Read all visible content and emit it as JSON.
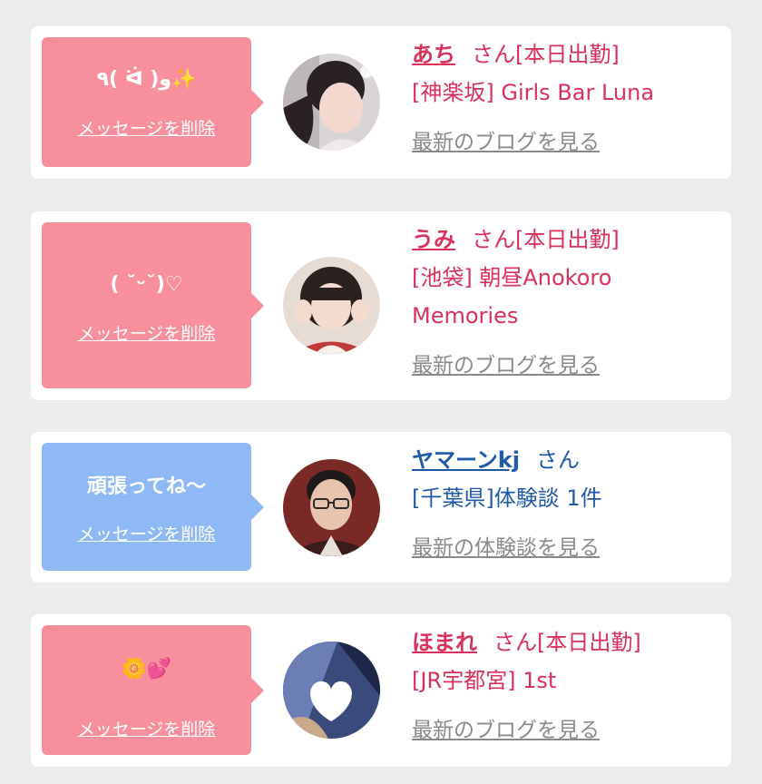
{
  "colors": {
    "pink_bubble": "#f7909c",
    "blue_bubble": "#8fb9f5",
    "cast_text": "#d9315a",
    "user_text": "#1f5aa8",
    "link_gray": "#8a8a8a"
  },
  "cards": [
    {
      "message": "٩( ᐛ )و✨",
      "delete_label": "メッセージを削除",
      "name": "あち",
      "suffix": "さん[本日出勤]",
      "shop_line1": "[神楽坂] Girls Bar Luna",
      "shop_line2": "",
      "link": "最新のブログを見る",
      "avatar_icon": "woman-selfie-photo"
    },
    {
      "message": "( ˘ᵕ˘)♡",
      "delete_label": "メッセージを削除",
      "name": "うみ",
      "suffix": "さん[本日出勤]",
      "shop_line1": "[池袋] 朝昼Anokoro",
      "shop_line2": "Memories",
      "link": "最新のブログを見る",
      "avatar_icon": "woman-peace-sign-photo"
    },
    {
      "message": "頑張ってね〜",
      "delete_label": "メッセージを削除",
      "name": "ヤマーンkj",
      "suffix": "さん",
      "shop_line1": "[千葉県]体験談 1件",
      "shop_line2": "",
      "link": "最新の体験談を見る",
      "avatar_icon": "man-glasses-photo"
    },
    {
      "message": "🌼💕",
      "delete_label": "メッセージを削除",
      "name": "ほまれ",
      "suffix": "さん[本日出勤]",
      "shop_line1": "[JR宇都宮] 1st",
      "shop_line2": "",
      "link": "最新のブログを見る",
      "avatar_icon": "heart-sticker-photo"
    }
  ]
}
